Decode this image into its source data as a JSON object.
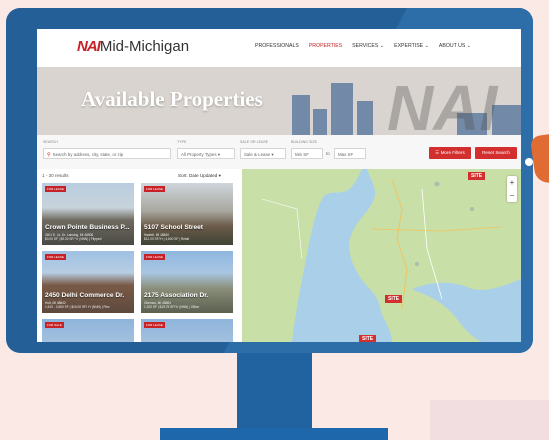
{
  "brand": {
    "mark": "NAI",
    "name": "Mid-Michigan"
  },
  "nav": {
    "items": [
      "PROFESSIONALS",
      "PROPERTIES",
      "SERVICES ⌄",
      "EXPERTISE ⌄",
      "ABOUT US ⌄"
    ],
    "active": "PROPERTIES"
  },
  "hero": {
    "title": "Available Properties",
    "watermark": "NAI"
  },
  "filters": {
    "search_label": "SEARCH",
    "search_placeholder": "Search by address, city, state, or zip",
    "type_label": "TYPE",
    "type_value": "All Property Types ▾",
    "sale_label": "SALE OR LEASE",
    "sale_value": "Sale & Lease ▾",
    "size_label": "BUILDING SIZE",
    "min_placeholder": "Min SF",
    "to_text": "to",
    "max_placeholder": "Max SF",
    "more_filters": "☰ More Filters",
    "reset": "Reset Search"
  },
  "list": {
    "results": "1 - 30 results",
    "sort": "Sort: Date Updated ▾",
    "cards": [
      {
        "badge": "FOR LEASE",
        "title": "Crown Pointe Business P...",
        "sub1": "3401 E. Lk. Dr. Lansing, MI 48906",
        "sub2": "$0.00 SF | $9.00 SF/ Yr (NNN) | Flipped"
      },
      {
        "badge": "FOR LEASE",
        "title": "5107 School Street",
        "sub1": "Haslett, MI 48840",
        "sub2": "$12.00 SF/Yr | 4,600 SF | Retail"
      },
      {
        "badge": "FOR LEASE",
        "title": "2450 Delhi Commerce Dr.",
        "sub1": "Holt, MI 48842",
        "sub2": "1,510 - 3,500 SF | $10.00 SF/ Yr (NNN) | Flex"
      },
      {
        "badge": "FOR LEASE",
        "title": "2175 Association Dr.",
        "sub1": "Okemos, MI 48864",
        "sub2": "1,320 SF | $15.75 SF/Yr (NNN) | Office"
      },
      {
        "badge": "FOR SALE",
        "title": "",
        "sub1": "",
        "sub2": ""
      },
      {
        "badge": "FOR LEASE",
        "title": "",
        "sub1": "",
        "sub2": ""
      }
    ]
  },
  "map": {
    "site_label": "SITE",
    "zoom_in": "+",
    "zoom_out": "−",
    "land_color": "#c9dfa8",
    "water_color": "#a9cfe9"
  },
  "colors": {
    "accent": "#c62227",
    "monitor": "#245f98",
    "background": "#fbe9e6"
  }
}
